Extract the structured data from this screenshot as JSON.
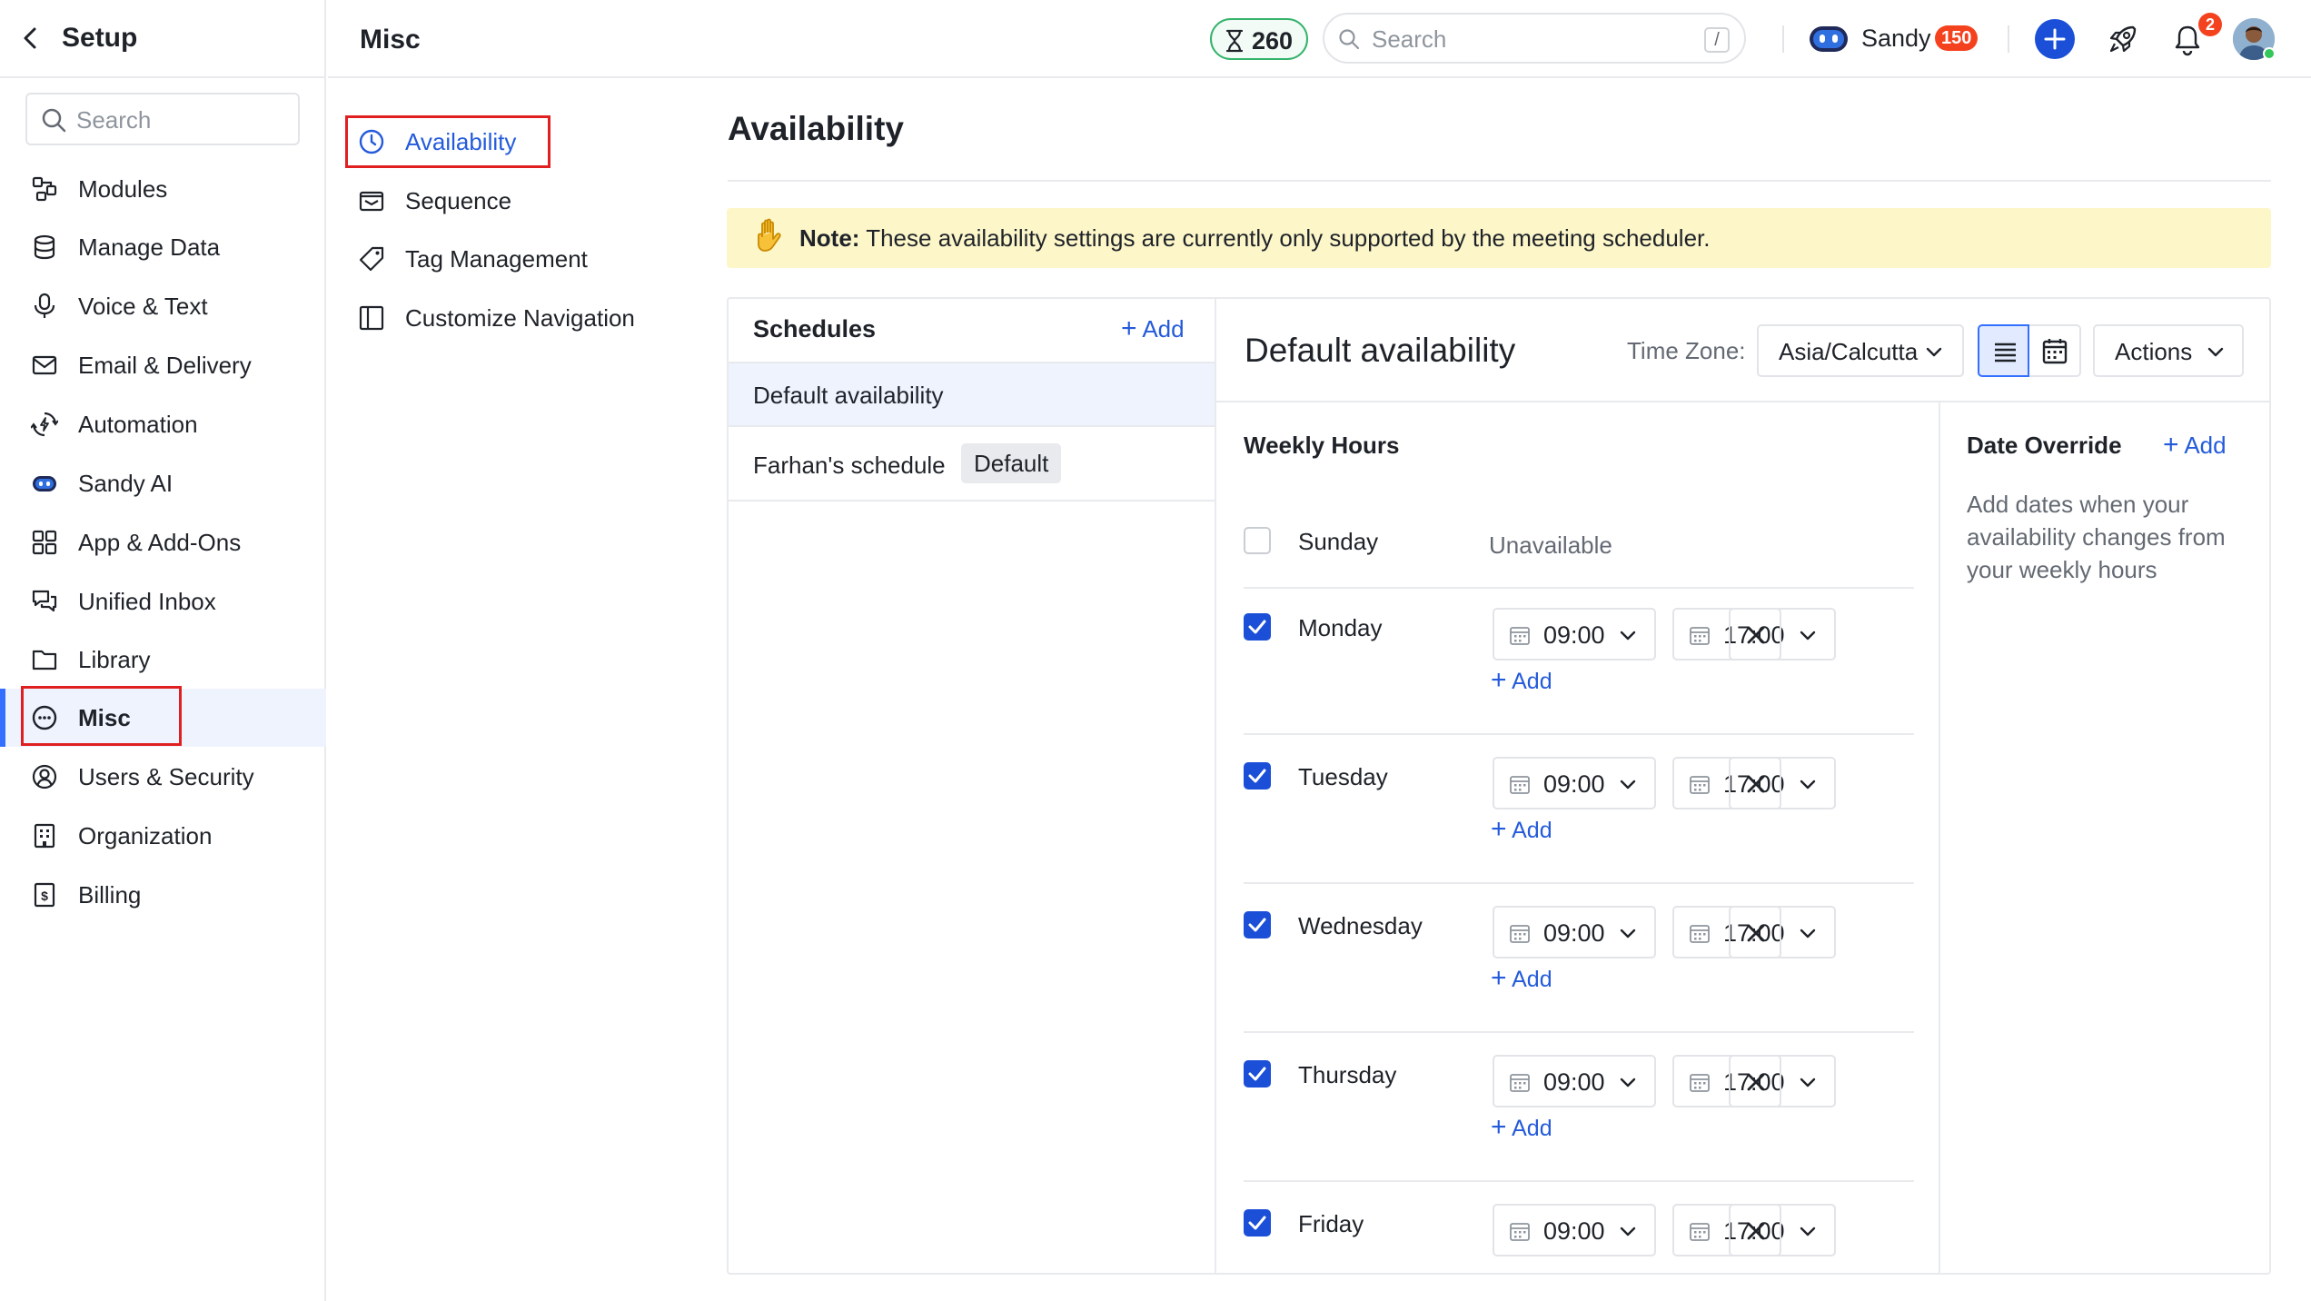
{
  "sidebar": {
    "title": "Setup",
    "search_placeholder": "Search",
    "items": [
      {
        "label": "Modules",
        "icon": "modules-icon"
      },
      {
        "label": "Manage Data",
        "icon": "database-icon"
      },
      {
        "label": "Voice & Text",
        "icon": "microphone-icon"
      },
      {
        "label": "Email & Delivery",
        "icon": "envelope-icon"
      },
      {
        "label": "Automation",
        "icon": "automation-icon"
      },
      {
        "label": "Sandy AI",
        "icon": "sandy-bot-icon"
      },
      {
        "label": "App & Add-Ons",
        "icon": "apps-grid-icon"
      },
      {
        "label": "Unified Inbox",
        "icon": "chat-bubbles-icon"
      },
      {
        "label": "Library",
        "icon": "folder-icon"
      },
      {
        "label": "Misc",
        "icon": "ellipsis-circle-icon"
      },
      {
        "label": "Users & Security",
        "icon": "user-circle-icon"
      },
      {
        "label": "Organization",
        "icon": "building-icon"
      },
      {
        "label": "Billing",
        "icon": "billing-icon"
      }
    ],
    "active_item": "Misc"
  },
  "header": {
    "section_title": "Misc",
    "credits": "260",
    "search_placeholder": "Search",
    "search_shortcut": "/",
    "assistant_name": "Sandy",
    "assistant_badge": "150",
    "notification_count": "2"
  },
  "subnav": {
    "items": [
      {
        "label": "Availability",
        "icon": "clock-icon"
      },
      {
        "label": "Sequence",
        "icon": "mail-tray-icon"
      },
      {
        "label": "Tag Management",
        "icon": "tag-icon"
      },
      {
        "label": "Customize Navigation",
        "icon": "sidebar-layout-icon"
      }
    ],
    "active_item": "Availability"
  },
  "main": {
    "title": "Availability",
    "note_label": "Note:",
    "note_text": "These availability settings are currently only supported by the meeting scheduler.",
    "schedules": {
      "header": "Schedules",
      "add_label": "Add",
      "items": [
        {
          "label": "Default availability",
          "tag": ""
        },
        {
          "label": "Farhan's schedule",
          "tag": "Default"
        }
      ]
    },
    "availability": {
      "title": "Default availability",
      "timezone_label": "Time Zone:",
      "timezone_value": "Asia/Calcutta",
      "actions_label": "Actions",
      "weekly_hours_title": "Weekly Hours",
      "add_label": "Add",
      "days": [
        {
          "day": "Sunday",
          "enabled": false,
          "status": "Unavailable",
          "start": "",
          "end": ""
        },
        {
          "day": "Monday",
          "enabled": true,
          "status": "",
          "start": "09:00",
          "end": "17:00"
        },
        {
          "day": "Tuesday",
          "enabled": true,
          "status": "",
          "start": "09:00",
          "end": "17:00"
        },
        {
          "day": "Wednesday",
          "enabled": true,
          "status": "",
          "start": "09:00",
          "end": "17:00"
        },
        {
          "day": "Thursday",
          "enabled": true,
          "status": "",
          "start": "09:00",
          "end": "17:00"
        },
        {
          "day": "Friday",
          "enabled": true,
          "status": "",
          "start": "09:00",
          "end": "17:00"
        }
      ],
      "date_override_title": "Date Override",
      "date_override_add": "Add",
      "date_override_desc": "Add dates when your availability changes from your weekly hours"
    }
  },
  "colors": {
    "accent": "#1b4fd8",
    "link": "#245bdb",
    "note_bg": "#fdf6c9",
    "highlight_box": "#e02020",
    "badge": "#f5421e",
    "credit_border": "#34b36b"
  }
}
